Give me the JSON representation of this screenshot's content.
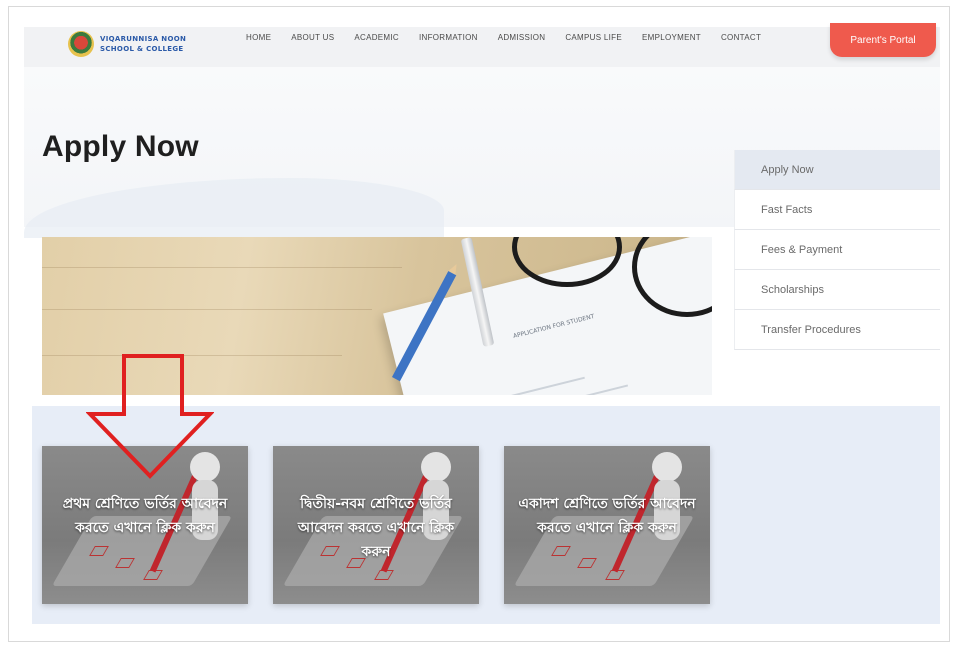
{
  "header": {
    "logo_line1": "VIQARUNNISA NOON",
    "logo_line2": "SCHOOL & COLLEGE",
    "nav": [
      "HOME",
      "ABOUT US",
      "ACADEMIC",
      "INFORMATION",
      "ADMISSION",
      "CAMPUS LIFE",
      "EMPLOYMENT",
      "CONTACT"
    ],
    "portal_label": "Parent's Portal"
  },
  "page": {
    "title": "Apply Now"
  },
  "sidebar": {
    "items": [
      {
        "label": "Apply Now"
      },
      {
        "label": "Fast Facts"
      },
      {
        "label": "Fees & Payment"
      },
      {
        "label": "Scholarships"
      },
      {
        "label": "Transfer Procedures"
      }
    ]
  },
  "photo": {
    "form_title": "APPLICATION FOR STUDENT"
  },
  "cards": [
    {
      "text": "প্রথম শ্রেণিতে ভর্তির আবেদন করতে এখানে ক্লিক করুন"
    },
    {
      "text": "দ্বিতীয়-নবম শ্রেণিতে ভর্তির আবেদন করতে এখানে ক্লিক করুন"
    },
    {
      "text": "একাদশ শ্রেণিতে ভর্তির আবেদন করতে এখানে ক্লিক করুন"
    }
  ],
  "colors": {
    "accent": "#ef5a4d",
    "annotation_arrow": "#e02020",
    "cards_bg": "#e7edf7"
  }
}
